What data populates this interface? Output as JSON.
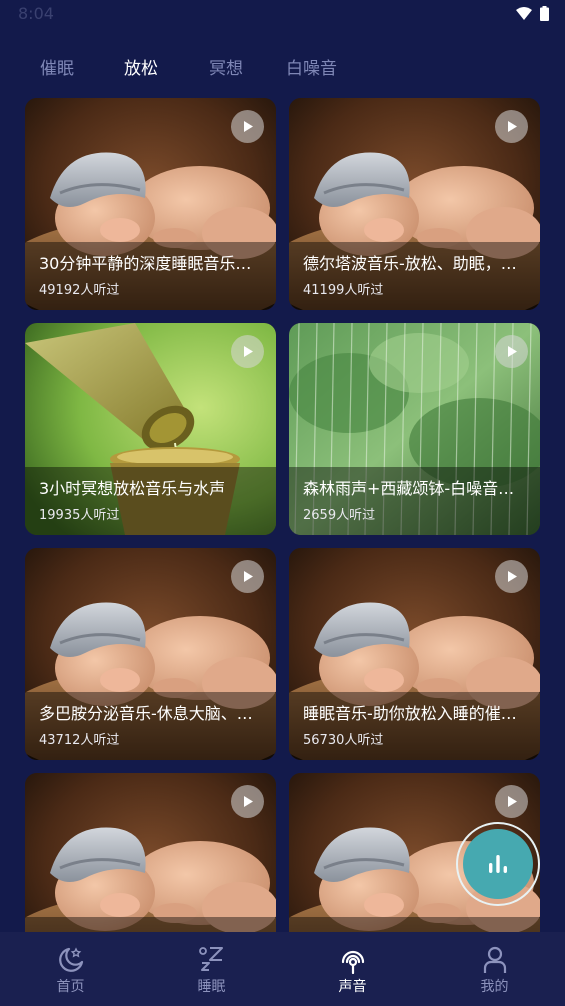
{
  "status_bar": {
    "time": "8:04"
  },
  "tabs": [
    {
      "label": "催眠",
      "active": false
    },
    {
      "label": "放松",
      "active": true
    },
    {
      "label": "冥想",
      "active": false
    },
    {
      "label": "白噪音",
      "active": false
    }
  ],
  "cards": [
    {
      "title": "30分钟平静的深度睡眠音乐…",
      "listeners": "49192人听过",
      "image": "sleeping-baby"
    },
    {
      "title": "德尔塔波音乐-放松、助眠，…",
      "listeners": "41199人听过",
      "image": "sleeping-baby"
    },
    {
      "title": "3小时冥想放松音乐与水声",
      "listeners": "19935人听过",
      "image": "bamboo-water"
    },
    {
      "title": "森林雨声+西藏颂钵-白噪音…",
      "listeners": "2659人听过",
      "image": "forest-rain"
    },
    {
      "title": "多巴胺分泌音乐-休息大脑、…",
      "listeners": "43712人听过",
      "image": "sleeping-baby"
    },
    {
      "title": "睡眠音乐-助你放松入睡的催…",
      "listeners": "56730人听过",
      "image": "sleeping-baby"
    },
    {
      "title": "",
      "listeners": "",
      "image": "sleeping-baby"
    },
    {
      "title": "",
      "listeners": "",
      "image": "sleeping-baby"
    }
  ],
  "bottom_nav": [
    {
      "label": "首页",
      "icon": "moon-home-icon",
      "active": false
    },
    {
      "label": "睡眠",
      "icon": "zzz-sleep-icon",
      "active": false
    },
    {
      "label": "声音",
      "icon": "sound-icon",
      "active": true
    },
    {
      "label": "我的",
      "icon": "profile-icon",
      "active": false
    }
  ],
  "colors": {
    "background": "#131a4b",
    "nav_background": "#1a2050",
    "fab": "#46a9b0",
    "tab_inactive": "#7f87b6"
  }
}
